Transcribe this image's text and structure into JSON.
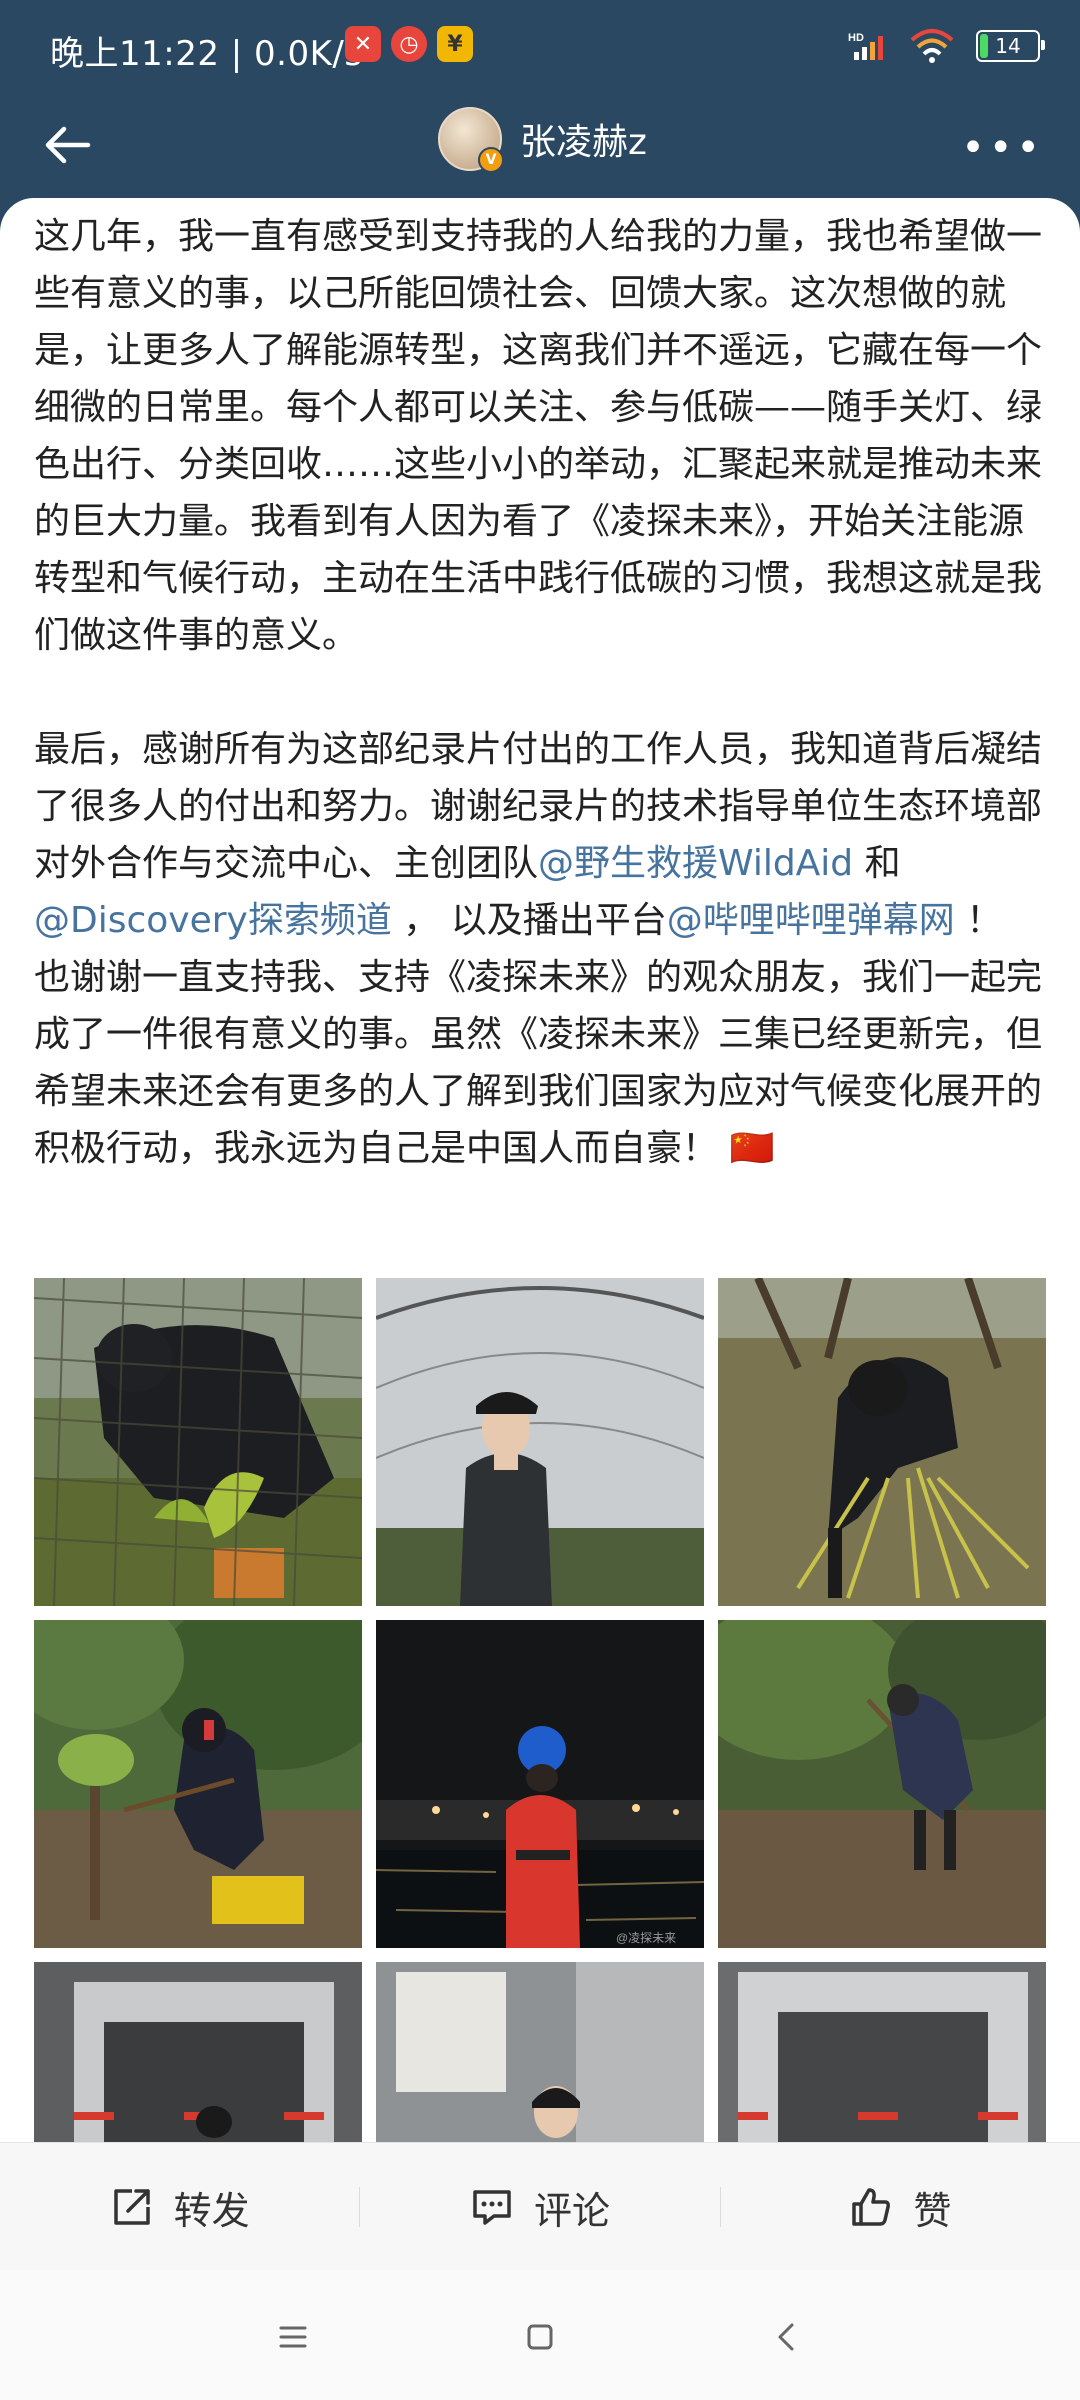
{
  "status_bar": {
    "time": "晚上11:22 | 0.0K/s",
    "battery": "14",
    "icons": [
      "mute-icon",
      "alarm-icon",
      "yuan-icon",
      "hd-signal-icon",
      "wifi-icon",
      "battery-icon"
    ]
  },
  "nav": {
    "username": "张凌赫z",
    "verified_badge": "V",
    "icons": [
      "back-arrow-icon",
      "more-icon"
    ]
  },
  "post": {
    "paragraph1": "这几年，我一直有感受到支持我的人给我的力量，我也希望做一些有意义的事，以己所能回馈社会、回馈大家。这次想做的就是，让更多人了解能源转型，这离我们并不遥远，它藏在每一个细微的日常里。每个人都可以关注、参与低碳——随手关灯、绿色出行、分类回收……这些小小的举动，汇聚起来就是推动未来的巨大力量。我看到有人因为看了《凌探未来》，开始关注能源转型和气候行动，主动在生活中践行低碳的习惯，我想这就是我们做这件事的意义。",
    "p2_a": "最后，感谢所有为这部纪录片付出的工作人员，我知道背后凝结了很多人的付出和努力。谢谢纪录片的技术指导单位生态环境部对外合作与交流中心、主创团队",
    "mention1": "@野生救援WildAid",
    "p2_b": " 和",
    "mention2": "@Discovery探索频道",
    "p2_c": " ， 以及播出平台",
    "mention3": "@哔哩哔哩弹幕网",
    "p2_d": " ！ 也谢谢一直支持我、支持《凌探未来》的观众朋友，我们一起完成了一件很有意义的事。虽然《凌探未来》三集已经更新完，但希望未来还会有更多的人了解到我们国家为应对气候变化展开的积极行动，我永远为自己是中国人而自豪！",
    "flag_emoji": "🇨🇳"
  },
  "photos": {
    "watermark": "@凌探未来",
    "items": [
      {
        "name": "photo-working-behind-fence"
      },
      {
        "name": "photo-greenhouse-portrait"
      },
      {
        "name": "photo-gathering-grass"
      },
      {
        "name": "photo-digging-soil"
      },
      {
        "name": "photo-night-port-lifevest"
      },
      {
        "name": "photo-digging-orchard"
      },
      {
        "name": "photo-factory-machine-1"
      },
      {
        "name": "photo-factory-portrait"
      },
      {
        "name": "photo-factory-machine-2"
      }
    ]
  },
  "actions": {
    "repost": "转发",
    "comment": "评论",
    "like": "赞"
  },
  "system_nav": {
    "icons": [
      "menu-icon",
      "home-icon",
      "back-icon"
    ]
  }
}
